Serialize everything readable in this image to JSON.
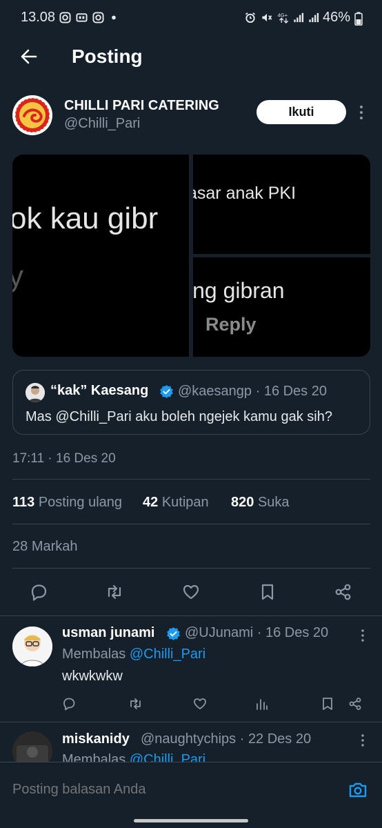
{
  "status_bar": {
    "time": "13.08",
    "battery": "46%",
    "network": "4G+"
  },
  "header": {
    "title": "Posting"
  },
  "author": {
    "name": "CHILLI PARI CATERING",
    "handle": "@Chilli_Pari",
    "follow_label": "Ikuti"
  },
  "media": {
    "left_text": "ok kau gibr",
    "left_fragment": "y",
    "right_top_text": "asar anak PKI",
    "right_bottom_text": "ing gibran",
    "right_bottom_reply": "Reply"
  },
  "quoted": {
    "name": "“kak” Kaesang",
    "handle_date": "@kaesangp · 16 Des 20",
    "text": "Mas @Chilli_Pari aku boleh ngejek kamu gak sih?"
  },
  "timestamp": "17:11 · 16 Des 20",
  "stats": {
    "reposts_count": "113",
    "reposts_label": "Posting ulang",
    "quotes_count": "42",
    "quotes_label": "Kutipan",
    "likes_count": "820",
    "likes_label": "Suka",
    "bookmarks_count": "28",
    "bookmarks_label": "Markah"
  },
  "actions": [
    "reply-icon",
    "repost-icon",
    "like-icon",
    "bookmark-icon",
    "share-icon"
  ],
  "replies": [
    {
      "name": "usman junami",
      "handle_date": "@UJunami · 16 Des 20",
      "replying_prefix": "Membalas",
      "replying_to": "@Chilli_Pari",
      "text": "wkwkwkw"
    },
    {
      "name": "miskanidy",
      "handle_date": "@naughtychips · 22 Des 20",
      "replying_prefix": "Membalas",
      "replying_to": "@Chilli_Pari"
    }
  ],
  "compose": {
    "placeholder": "Posting balasan Anda"
  },
  "colors": {
    "background": "#15202b",
    "muted": "#8b98a5",
    "link": "#1d9bf0",
    "verified": "#1d9bf0"
  }
}
